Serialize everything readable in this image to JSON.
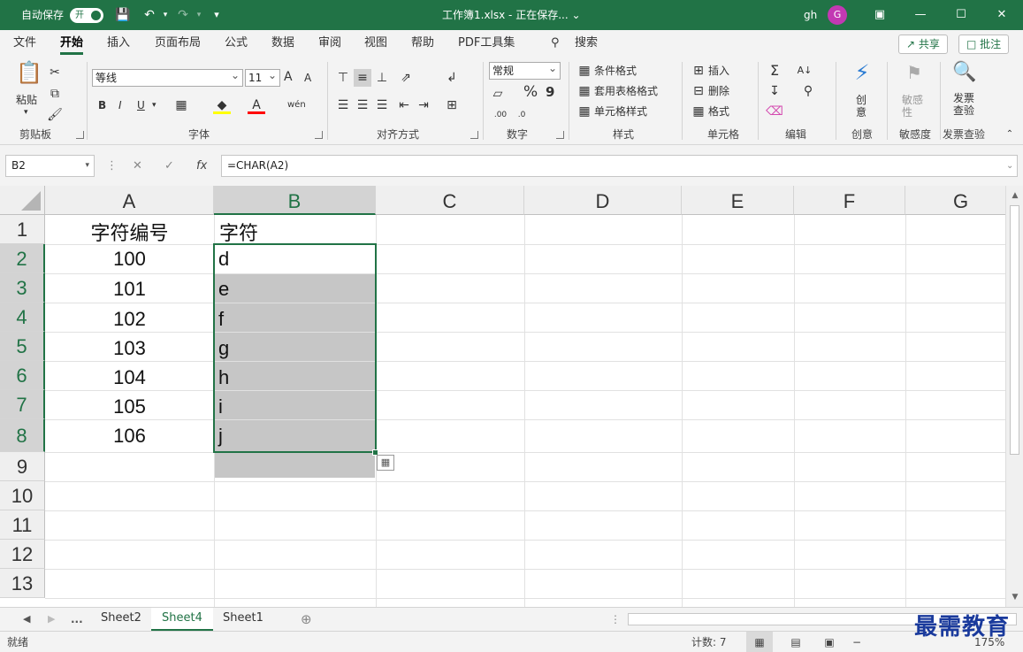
{
  "titlebar": {
    "autosave_label": "自动保存",
    "autosave_state": "开",
    "file_title": "工作簿1.xlsx - 正在保存... ⌄",
    "user_name": "gh",
    "avatar_initial": "G"
  },
  "menu": {
    "tabs": [
      "文件",
      "开始",
      "插入",
      "页面布局",
      "公式",
      "数据",
      "审阅",
      "视图",
      "帮助",
      "PDF工具集"
    ],
    "search_label": "搜索",
    "share_label": "共享",
    "comment_label": "批注"
  },
  "ribbon": {
    "clipboard": {
      "paste_label": "粘贴",
      "group_label": "剪贴板"
    },
    "font": {
      "font_name": "等线",
      "font_size": "11",
      "group_label": "字体",
      "bold": "B",
      "italic": "I",
      "underline": "U",
      "grow": "A",
      "shrink": "A"
    },
    "alignment": {
      "group_label": "对齐方式"
    },
    "number": {
      "format": "常规",
      "percent": "%",
      "comma": "9",
      "group_label": "数字"
    },
    "styles": {
      "cond_format": "条件格式",
      "table_format": "套用表格格式",
      "cell_styles": "单元格样式",
      "group_label": "样式"
    },
    "cells": {
      "insert": "插入",
      "delete": "删除",
      "format": "格式",
      "group_label": "单元格"
    },
    "editing": {
      "group_label": "编辑"
    },
    "creative": {
      "button": "创意",
      "group_label": "创意"
    },
    "sensitivity": {
      "button": "敏感性",
      "group_label": "敏感度"
    },
    "invoice": {
      "button": "发票查验",
      "group_label": "发票查验"
    }
  },
  "formula_bar": {
    "name_box": "B2",
    "fx": "fx",
    "formula": "=CHAR(A2)"
  },
  "sheet": {
    "columns": [
      "A",
      "B",
      "C",
      "D",
      "E",
      "F",
      "G"
    ],
    "rows": [
      "1",
      "2",
      "3",
      "4",
      "5",
      "6",
      "7",
      "8",
      "9",
      "10",
      "11",
      "12",
      "13"
    ],
    "header_a": "字符编号",
    "header_b": "字符",
    "col_a_values": [
      "100",
      "101",
      "102",
      "103",
      "104",
      "105",
      "106"
    ],
    "col_b_values": [
      "d",
      "e",
      "f",
      "g",
      "h",
      "i",
      "j"
    ]
  },
  "tabs": {
    "more": "...",
    "sheets": [
      "Sheet2",
      "Sheet4",
      "Sheet1"
    ],
    "active": "Sheet4"
  },
  "status": {
    "ready": "就绪",
    "count": "计数: 7",
    "zoom": "175%",
    "watermark": "最需教育"
  },
  "colors": {
    "accent": "#217346",
    "selection": "#c6c6c6",
    "avatar": "#c239b3"
  }
}
